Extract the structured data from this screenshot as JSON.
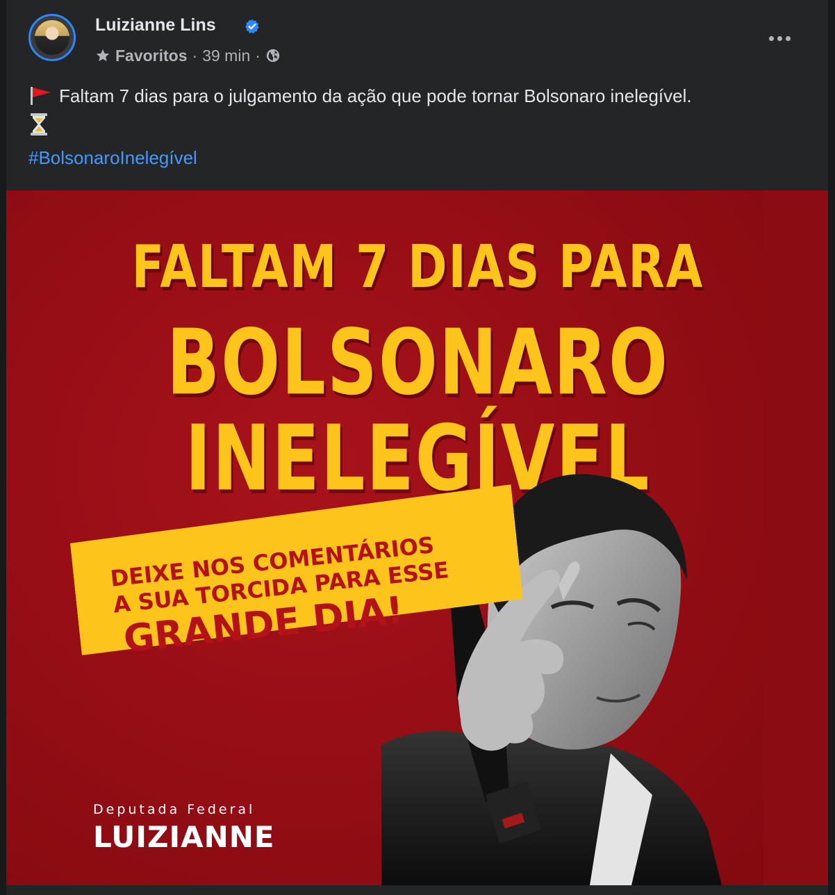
{
  "post": {
    "author": "Luizianne Lins",
    "audience": "Favoritos",
    "time": "39 min",
    "separator": "·",
    "caption": "Faltam 7 dias para o julgamento da ação que pode tornar Bolsonaro inelegível.",
    "hashtag": "#BolsonaroInelegível",
    "icons": [
      "verified-badge-icon",
      "star-icon",
      "globe-icon",
      "more-options-icon",
      "red-flag-icon",
      "hourglass-icon"
    ]
  },
  "image": {
    "headline_line1": "FALTAM 7 DIAS PARA",
    "headline_line2": "BOLSONARO",
    "headline_line3": "INELEGÍVEL",
    "banner_line1": "DEIXE NOS COMENTÁRIOS",
    "banner_line2": "A SUA TORCIDA PARA ESSE",
    "banner_line3": "GRANDE DIA!",
    "signature_title": "Deputada Federal",
    "signature_name": "LUIZIANNE"
  },
  "colors": {
    "background": "#242526",
    "text": "#e4e6eb",
    "secondary_text": "#b0b3b8",
    "link": "#4599ff",
    "verified": "#2d88ff",
    "poster_red": "#8e0c13",
    "poster_yellow": "#fdc51c"
  }
}
